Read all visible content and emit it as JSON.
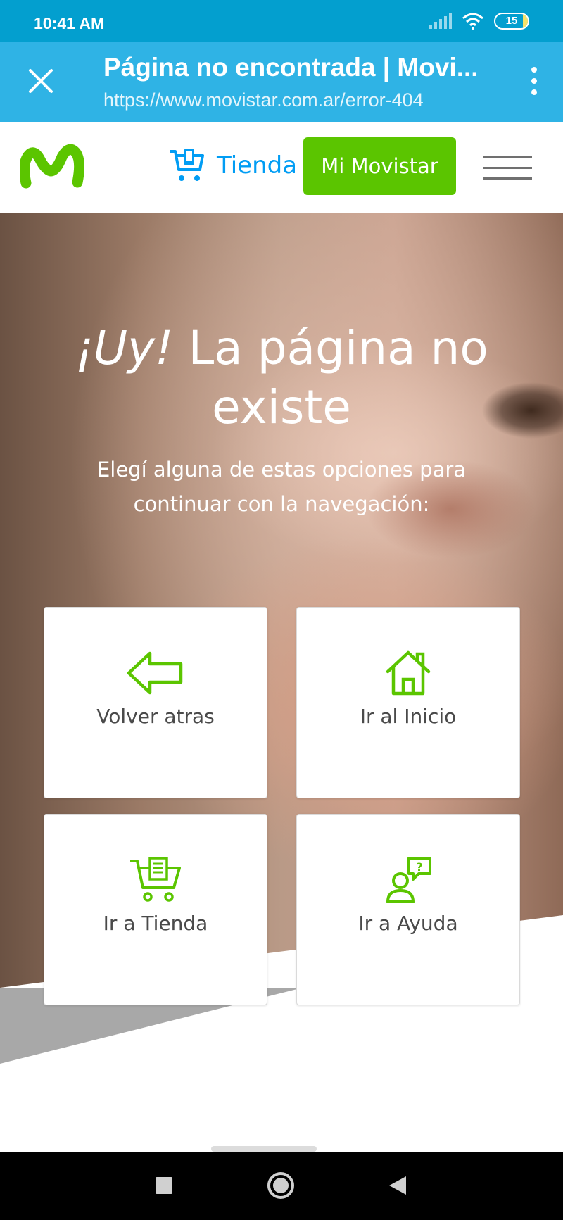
{
  "status_bar": {
    "time": "10:41 AM",
    "battery": "15"
  },
  "browser": {
    "title": "Página no encontrada | Movi...",
    "url": "https://www.movistar.com.ar/error-404"
  },
  "header": {
    "tienda_label": "Tienda",
    "mi_movistar_label": "Mi Movistar"
  },
  "hero": {
    "title_emphasis": "¡Uy!",
    "title_rest": " La página no existe",
    "subtitle": "Elegí alguna de estas opciones para continuar con la navegación:"
  },
  "options": [
    {
      "label": "Volver atras",
      "icon": "arrow-left-icon"
    },
    {
      "label": "Ir al Inicio",
      "icon": "home-icon"
    },
    {
      "label": "Ir a Tienda",
      "icon": "cart-icon"
    },
    {
      "label": "Ir a Ayuda",
      "icon": "help-chat-icon"
    }
  ],
  "colors": {
    "brand_green": "#5bc500",
    "brand_blue": "#019df4",
    "browser_bar": "#2fb3e5",
    "status_bar": "#039fcf"
  }
}
